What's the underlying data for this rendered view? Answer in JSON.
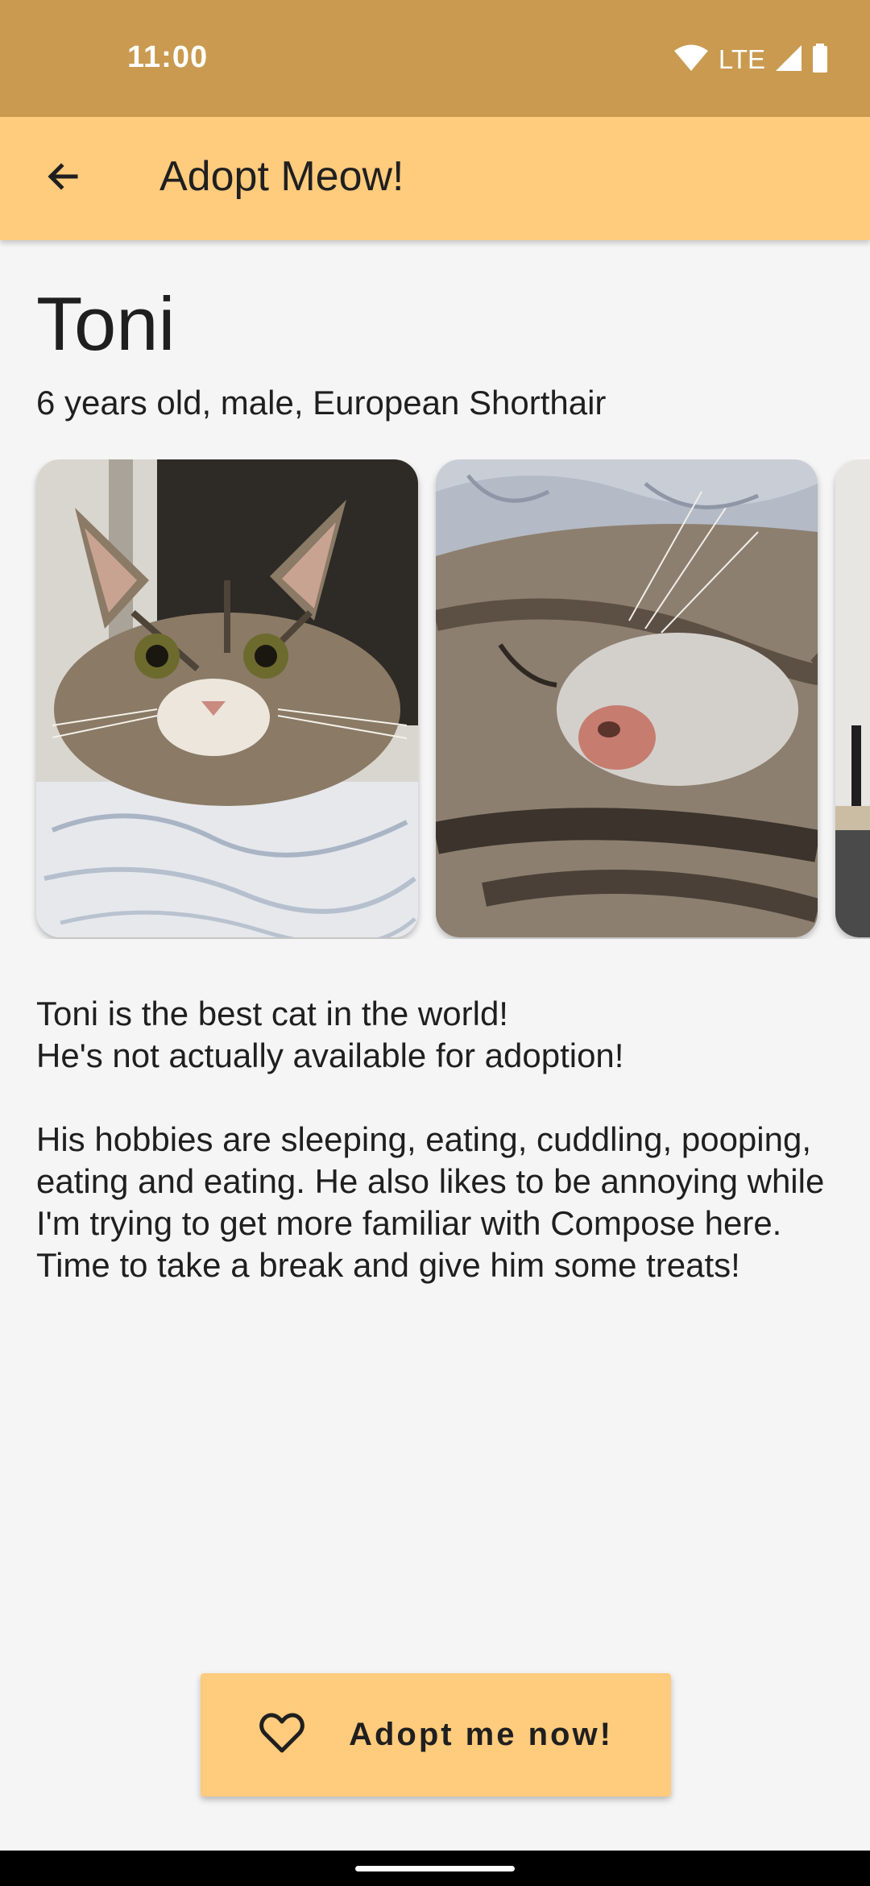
{
  "status_bar": {
    "time": "11:00",
    "network": "LTE",
    "icons": [
      "wifi-icon",
      "cell-signal-icon",
      "battery-icon"
    ]
  },
  "app_bar": {
    "title": "Adopt Meow!",
    "back_icon": "arrow-back-icon"
  },
  "pet": {
    "name": "Toni",
    "subtitle": "6 years old, male, European Shorthair"
  },
  "gallery": {
    "photos": [
      "cat-photo-lying",
      "cat-photo-sleeping",
      "cat-photo-partial"
    ]
  },
  "description": {
    "paragraph1_line1": "Toni is the best cat in the world!",
    "paragraph1_line2": "He's not actually available for adoption!",
    "paragraph2": "His hobbies are sleeping, eating, cuddling, pooping, eating and eating. He also likes to be annoying while I'm trying to get more familiar with Compose here. Time to take a break and give him some treats!"
  },
  "adopt_button": {
    "label": "Adopt me now!",
    "icon": "heart-outline-icon"
  },
  "colors": {
    "status_bar": "#c99a50",
    "app_bar": "#ffcb7d",
    "background": "#f5f5f5",
    "button": "#ffcb7d"
  }
}
